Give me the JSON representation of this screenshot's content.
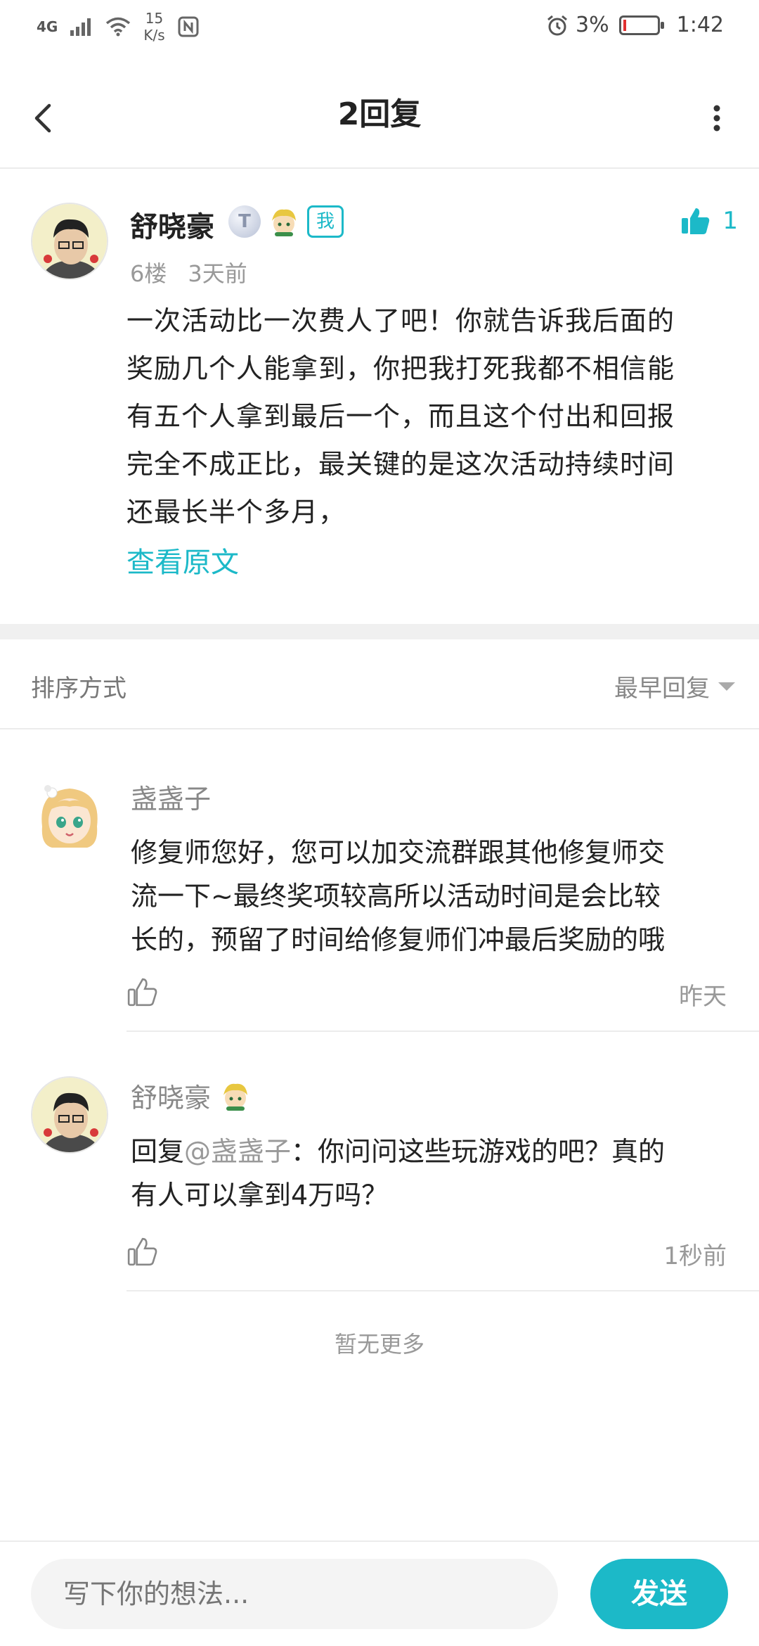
{
  "status_bar": {
    "network": "4G",
    "speed_value": "15",
    "speed_unit": "K/s",
    "battery": "3%",
    "time": "1:42"
  },
  "header": {
    "title": "2回复",
    "back_icon": "chevron-left-icon",
    "more_icon": "more-vertical-icon"
  },
  "post": {
    "author": "舒晓豪",
    "level_badge": "T",
    "me_badge": "我",
    "likes": "1",
    "floor": "6楼",
    "time": "3天前",
    "lines": [
      "一次活动比一次费人了吧！你就告诉我后面的",
      "奖励几个人能拿到，你把我打死我都不相信能",
      "有五个人拿到最后一个，而且这个付出和回报",
      "完全不成正比，最关键的是这次活动持续时间",
      "还最长半个多月，"
    ],
    "view_original": "查看原文"
  },
  "sort": {
    "label": "排序方式",
    "selected": "最早回复"
  },
  "replies": [
    {
      "author": "盏盏子",
      "lines": [
        "修复师您好，您可以加交流群跟其他修复师交",
        "流一下~最终奖项较高所以活动时间是会比较",
        "长的，预留了时间给修复师们冲最后奖励的哦"
      ],
      "time": "昨天"
    },
    {
      "author": "舒晓豪",
      "reply_prefix": "回复",
      "mention": "@盏盏子",
      "line1_rest": "：你问问这些玩游戏的吧？真的",
      "line2": "有人可以拿到4万吗？",
      "time": "1秒前"
    }
  ],
  "footer": {
    "no_more": "暂无更多",
    "input_placeholder": "写下你的想法...",
    "send_label": "发送"
  },
  "colors": {
    "accent": "#1cb9c8",
    "battery_low": "#e03030"
  }
}
